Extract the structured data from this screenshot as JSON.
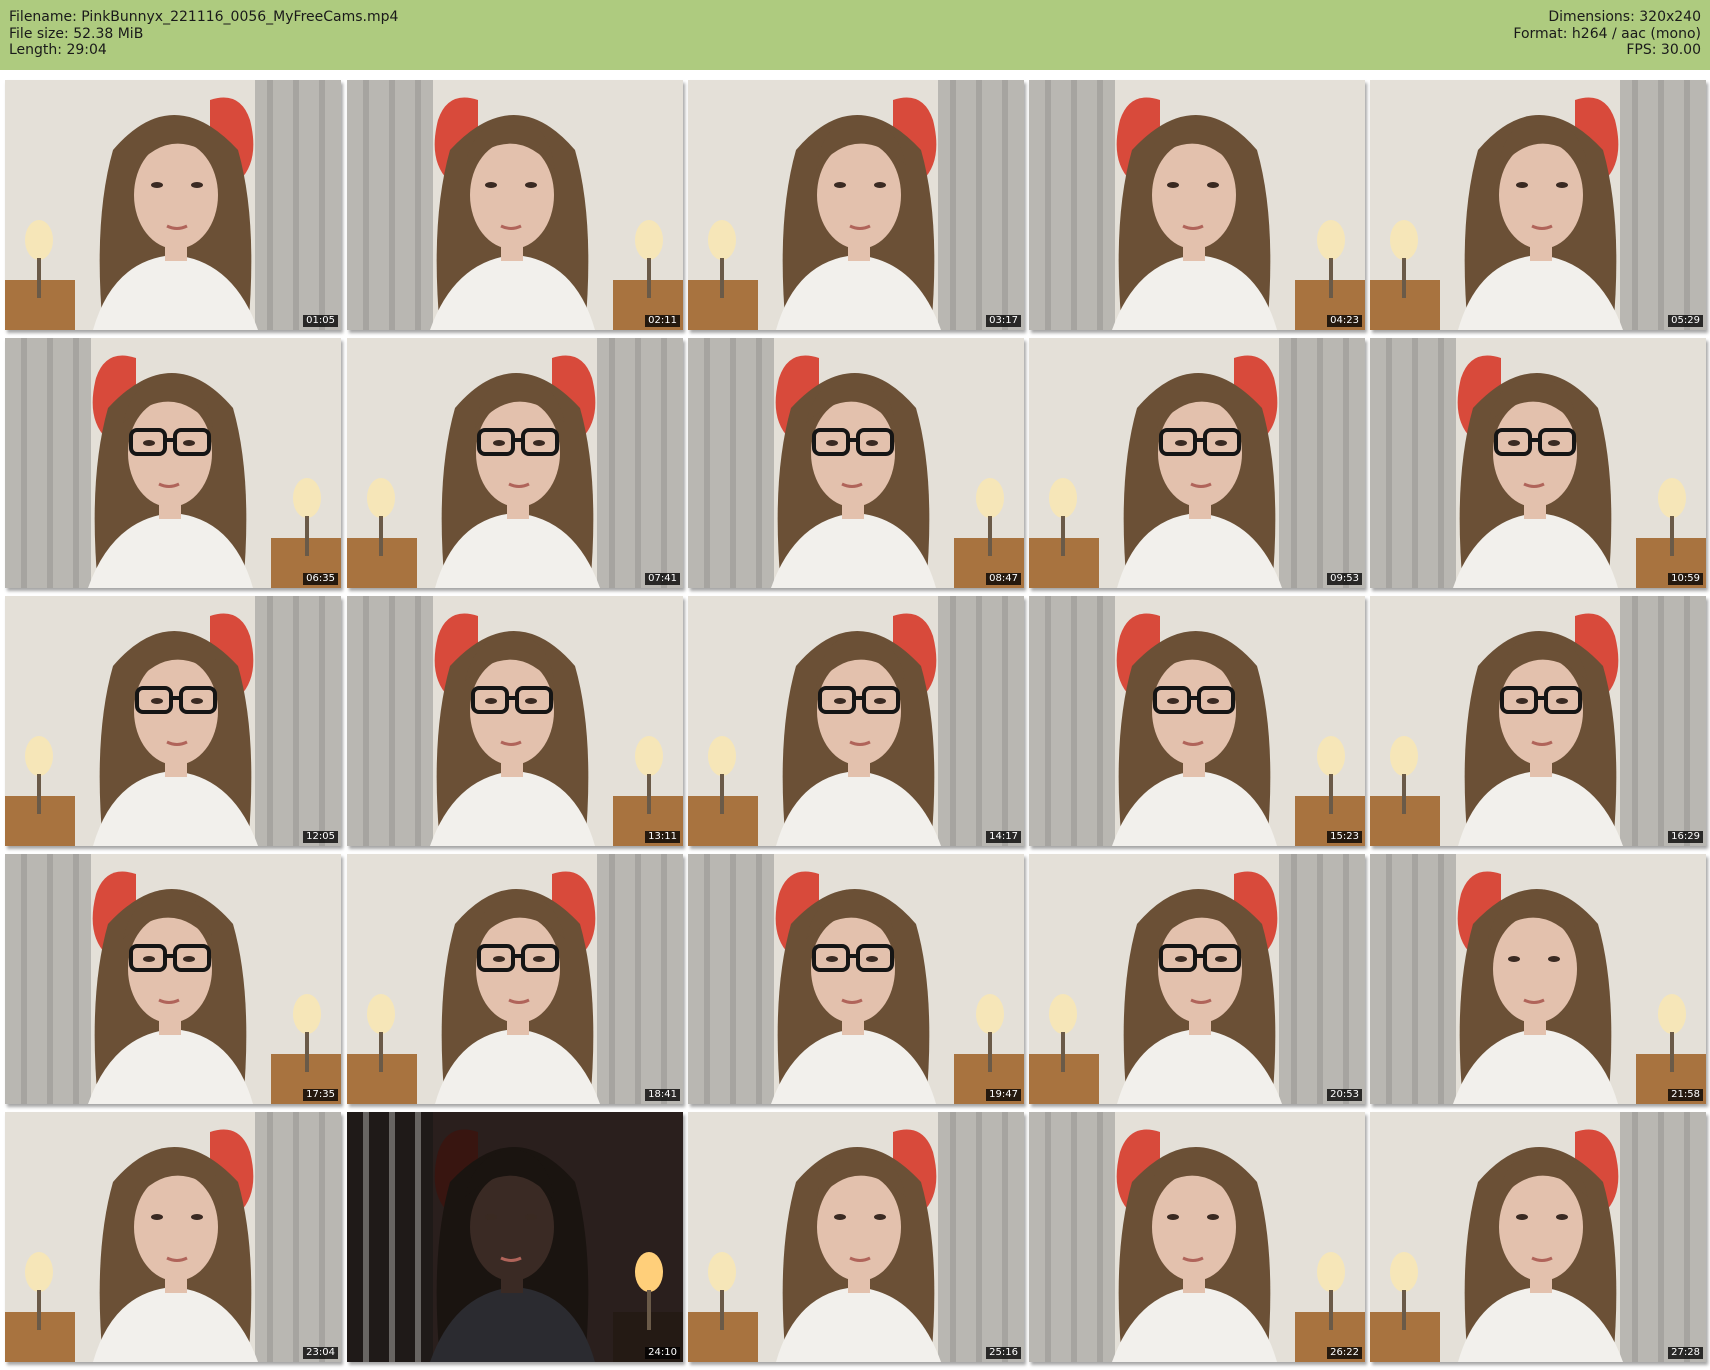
{
  "header": {
    "filename_line": "Filename: PinkBunnyx_221116_0056_MyFreeCams.mp4",
    "filesize_line": "File size: 52.38 MiB",
    "length_line": "Length: 29:04",
    "dimensions_line": "Dimensions: 320x240",
    "format_line": "Format: h264 / aac (mono)",
    "fps_line": "FPS: 30.00"
  },
  "colors": {
    "header_bg": "#aecb7f",
    "page_bg": "#ffffff"
  },
  "thumbnails": [
    {
      "timestamp": "01:05",
      "glasses": false,
      "dark": false
    },
    {
      "timestamp": "02:11",
      "glasses": false,
      "dark": false
    },
    {
      "timestamp": "03:17",
      "glasses": false,
      "dark": false
    },
    {
      "timestamp": "04:23",
      "glasses": false,
      "dark": false
    },
    {
      "timestamp": "05:29",
      "glasses": false,
      "dark": false
    },
    {
      "timestamp": "06:35",
      "glasses": true,
      "dark": false
    },
    {
      "timestamp": "07:41",
      "glasses": true,
      "dark": false
    },
    {
      "timestamp": "08:47",
      "glasses": true,
      "dark": false
    },
    {
      "timestamp": "09:53",
      "glasses": true,
      "dark": false
    },
    {
      "timestamp": "10:59",
      "glasses": true,
      "dark": false
    },
    {
      "timestamp": "12:05",
      "glasses": true,
      "dark": false
    },
    {
      "timestamp": "13:11",
      "glasses": true,
      "dark": false
    },
    {
      "timestamp": "14:17",
      "glasses": true,
      "dark": false
    },
    {
      "timestamp": "15:23",
      "glasses": true,
      "dark": false
    },
    {
      "timestamp": "16:29",
      "glasses": true,
      "dark": false
    },
    {
      "timestamp": "17:35",
      "glasses": true,
      "dark": false
    },
    {
      "timestamp": "18:41",
      "glasses": true,
      "dark": false
    },
    {
      "timestamp": "19:47",
      "glasses": true,
      "dark": false
    },
    {
      "timestamp": "20:53",
      "glasses": true,
      "dark": false
    },
    {
      "timestamp": "21:58",
      "glasses": false,
      "dark": false
    },
    {
      "timestamp": "23:04",
      "glasses": false,
      "dark": false
    },
    {
      "timestamp": "24:10",
      "glasses": false,
      "dark": true
    },
    {
      "timestamp": "25:16",
      "glasses": false,
      "dark": false
    },
    {
      "timestamp": "26:22",
      "glasses": false,
      "dark": false
    },
    {
      "timestamp": "27:28",
      "glasses": false,
      "dark": false
    }
  ]
}
